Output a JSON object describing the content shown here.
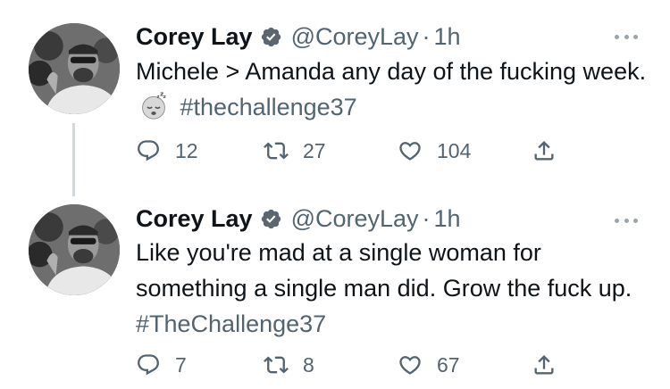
{
  "tweets": [
    {
      "author": "Corey Lay",
      "handle": "@CoreyLay",
      "separator": "·",
      "time": "1h",
      "text": "Michele > Amanda any day of the fucking week.",
      "emoji": "sleeping-face",
      "hashtag": "#thechallenge37",
      "reply_count": "12",
      "retweet_count": "27",
      "like_count": "104"
    },
    {
      "author": "Corey Lay",
      "handle": "@CoreyLay",
      "separator": "·",
      "time": "1h",
      "text": "Like you're mad at a single woman for something a single man did. Grow the fuck up.",
      "hashtag": "#TheChallenge37",
      "reply_count": "7",
      "retweet_count": "8",
      "like_count": "67"
    }
  ],
  "icons": [
    "verified-badge-icon",
    "more-options-icon",
    "reply-icon",
    "retweet-icon",
    "like-icon",
    "share-icon"
  ],
  "colors": {
    "text": "#0f1419",
    "secondary": "#536471",
    "thread_line": "#cfd9de",
    "background": "#ffffff"
  }
}
